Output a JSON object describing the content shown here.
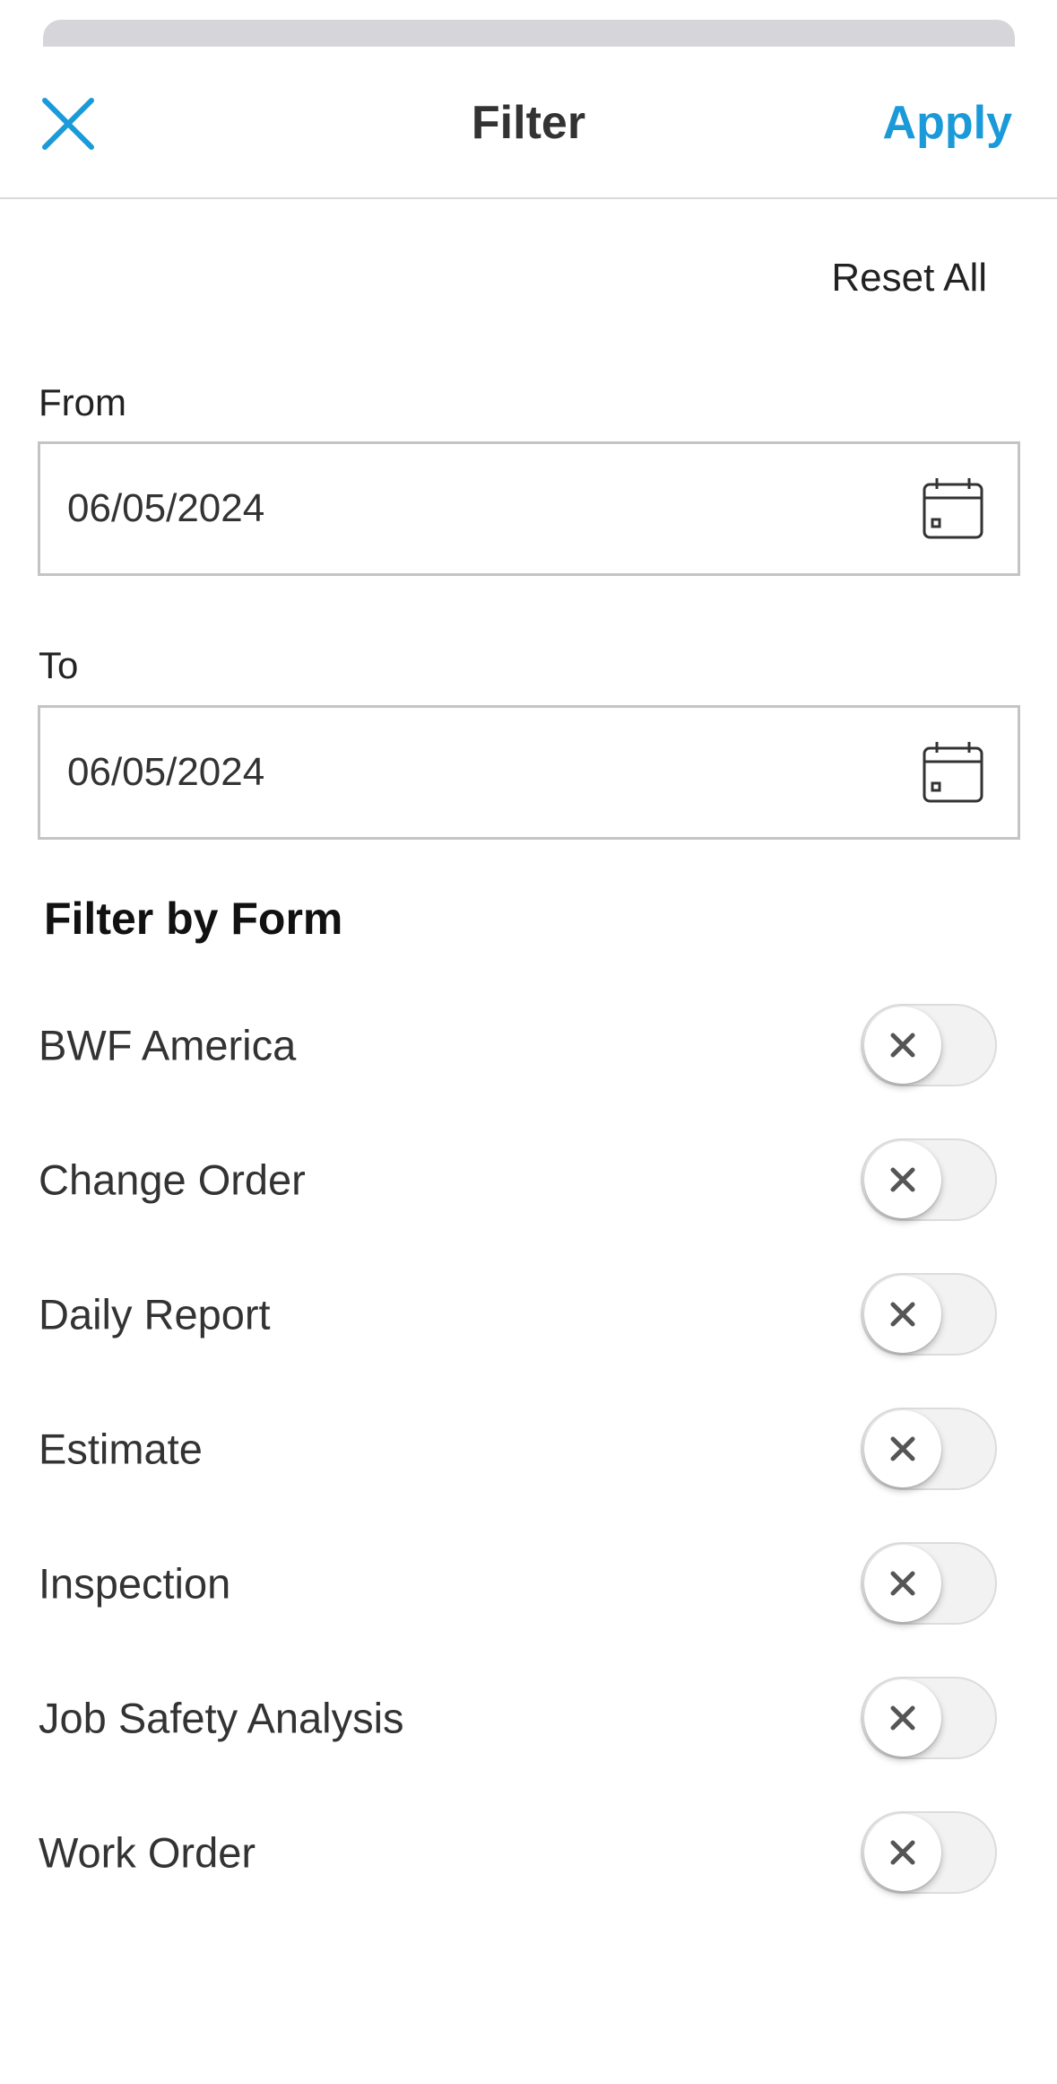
{
  "header": {
    "title": "Filter",
    "apply_label": "Apply",
    "close_icon": "close-icon"
  },
  "reset_label": "Reset All",
  "from": {
    "label": "From",
    "value": "06/05/2024",
    "icon": "calendar-icon"
  },
  "to": {
    "label": "To",
    "value": "06/05/2024",
    "icon": "calendar-icon"
  },
  "filter_by_form": {
    "title": "Filter by Form",
    "items": [
      {
        "label": "BWF America",
        "enabled": false
      },
      {
        "label": "Change Order",
        "enabled": false
      },
      {
        "label": "Daily Report",
        "enabled": false
      },
      {
        "label": "Estimate",
        "enabled": false
      },
      {
        "label": "Inspection",
        "enabled": false
      },
      {
        "label": "Job Safety Analysis",
        "enabled": false
      },
      {
        "label": "Work Order",
        "enabled": false
      }
    ]
  },
  "colors": {
    "accent": "#1a9ad8",
    "toggle_off_track": "#f2f2f2",
    "border": "#c4c4c4"
  }
}
